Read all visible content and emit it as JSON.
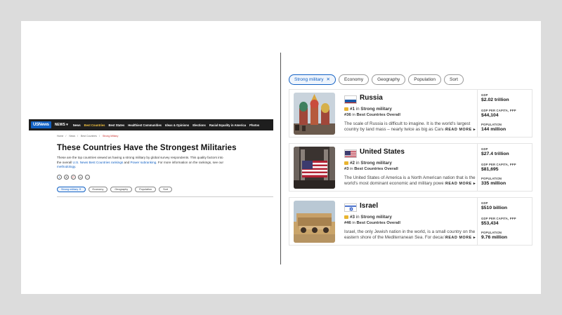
{
  "site": {
    "logo": "USNews",
    "nav": [
      "NEWS ▾",
      "News",
      "Best Countries",
      "Best States",
      "Healthiest Communities",
      "Ideas & Opinions",
      "Elections",
      "Racial Equality in America",
      "Photos"
    ]
  },
  "breadcrumb": [
    "Home",
    "News",
    "Best Countries",
    "Strong Military"
  ],
  "page": {
    "title": "These Countries Have the Strongest Militaries",
    "intro_1": "These are the top countries viewed as having a strong military by global survey respondents. This quality factors into the overall ",
    "intro_link1": "U.S. News Best Countries rankings",
    "intro_2": " and ",
    "intro_link2": "Power subranking",
    "intro_3": ". For more information on the rankings, see our ",
    "intro_link3": "methodology",
    "intro_4": "."
  },
  "share_icons": [
    "facebook-icon",
    "x-icon",
    "pinterest-icon",
    "link-icon",
    "more-icon"
  ],
  "filters": {
    "active": "Strong military",
    "close": "✕",
    "others": [
      "Economy",
      "Geography",
      "Population",
      "Sort"
    ]
  },
  "countries": [
    {
      "name": "Russia",
      "rank": "#1",
      "rank_in": "in",
      "category": "Strong military",
      "overall_rank": "#36",
      "overall_in": "in",
      "overall_label": "Best Countries Overall",
      "description": "The scale of Russia is difficult to imagine. It is the world's largest country by land mass – nearly twice as big as Canada.",
      "more": "READ MORE ▸",
      "gdp_label": "GDP",
      "gdp": "$2.02 trillion",
      "gdp_pc_label": "GDP PER CAPITA, PPP",
      "gdp_pc": "$44,104",
      "pop_label": "POPULATION",
      "population": "144 million"
    },
    {
      "name": "United States",
      "rank": "#2",
      "rank_in": "in",
      "category": "Strong military",
      "overall_rank": "#3",
      "overall_in": "in",
      "overall_label": "Best Countries Overall",
      "description": "The United States of America is a North American nation that is the world's most dominant economic and military power.",
      "more": "READ MORE ▸",
      "gdp_label": "GDP",
      "gdp": "$27.4 trillion",
      "gdp_pc_label": "GDP PER CAPITA, PPP",
      "gdp_pc": "$81,695",
      "pop_label": "POPULATION",
      "population": "335 million"
    },
    {
      "name": "Israel",
      "rank": "#3",
      "rank_in": "in",
      "category": "Strong military",
      "overall_rank": "#46",
      "overall_in": "in",
      "overall_label": "Best Countries Overall",
      "description": "Israel, the only Jewish nation in the world, is a small country on the eastern shore of the Mediterranean Sea. For decades...",
      "more": "READ MORE ▸",
      "gdp_label": "GDP",
      "gdp": "$510 billion",
      "gdp_pc_label": "GDP PER CAPITA, PPP",
      "gdp_pc": "$53,434",
      "pop_label": "POPULATION",
      "population": "9.76 million"
    }
  ]
}
